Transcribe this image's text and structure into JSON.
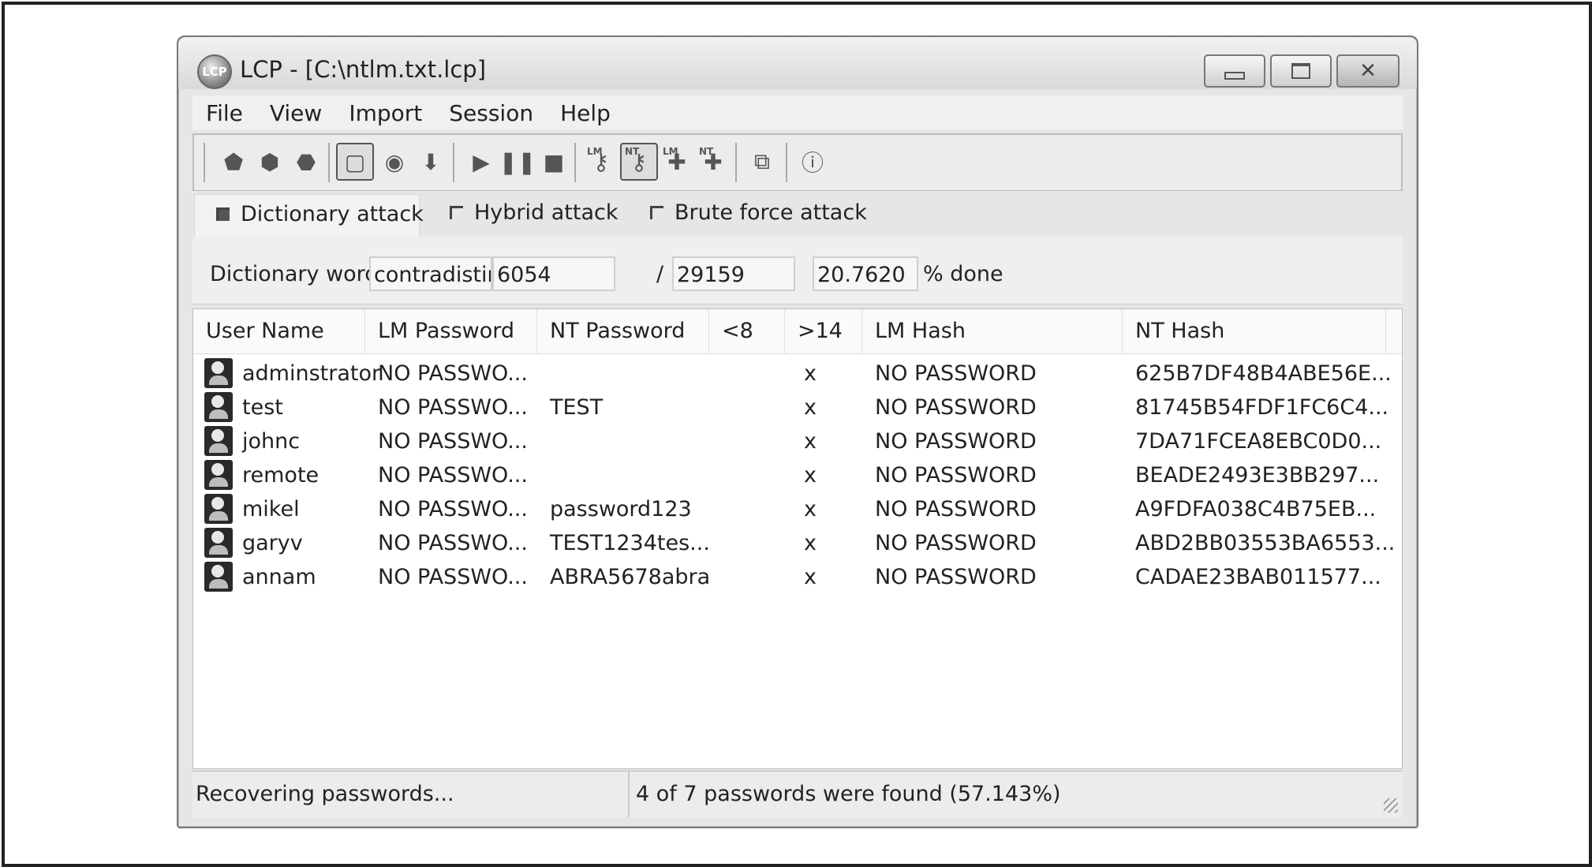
{
  "window": {
    "app_icon_text": "LCP",
    "title": "LCP - [C:\\ntlm.txt.lcp]"
  },
  "menu": [
    "File",
    "View",
    "Import",
    "Session",
    "Help"
  ],
  "toolbar_icons": [
    "new-session-icon",
    "open-session-icon",
    "save-session-icon",
    "pause-view-icon",
    "options-icon",
    "import-icon",
    "start-icon",
    "pause-icon",
    "stop-icon",
    "lm-key-icon",
    "nt-key-icon",
    "lm-add-icon",
    "nt-add-icon",
    "export-icon",
    "info-icon"
  ],
  "toolbar_key_labels": {
    "lm": "LM",
    "nt": "NT"
  },
  "attack_tabs": [
    {
      "label": "Dictionary attack",
      "checked": true
    },
    {
      "label": "Hybrid attack",
      "checked": false
    },
    {
      "label": "Brute force attack",
      "checked": false
    }
  ],
  "dictionary": {
    "label": "Dictionary word:",
    "word": "contradisting",
    "current": "6054",
    "separator": "/",
    "total": "29159",
    "percent": "20.7620",
    "done_label": "% done"
  },
  "table": {
    "columns": [
      "User Name",
      "LM Password",
      "NT Password",
      "<8",
      ">14",
      "LM Hash",
      "NT Hash"
    ],
    "rows": [
      {
        "user": "adminstrator",
        "lm_password": "NO PASSWO...",
        "nt_password": "",
        "lt8": "",
        "gt14": "x",
        "lm_hash": "NO PASSWORD",
        "nt_hash": "625B7DF48B4ABE56E..."
      },
      {
        "user": "test",
        "lm_password": "NO PASSWO...",
        "nt_password": "TEST",
        "lt8": "",
        "gt14": "x",
        "lm_hash": "NO PASSWORD",
        "nt_hash": "81745B54FDF1FC6C4..."
      },
      {
        "user": "johnc",
        "lm_password": "NO PASSWO...",
        "nt_password": "",
        "lt8": "",
        "gt14": "x",
        "lm_hash": "NO PASSWORD",
        "nt_hash": "7DA71FCEA8EBC0D0..."
      },
      {
        "user": "remote",
        "lm_password": "NO PASSWO...",
        "nt_password": "",
        "lt8": "",
        "gt14": "x",
        "lm_hash": "NO PASSWORD",
        "nt_hash": "BEADE2493E3BB297..."
      },
      {
        "user": "mikel",
        "lm_password": "NO PASSWO...",
        "nt_password": "password123",
        "lt8": "",
        "gt14": "x",
        "lm_hash": "NO PASSWORD",
        "nt_hash": "A9FDFA038C4B75EB..."
      },
      {
        "user": "garyv",
        "lm_password": "NO PASSWO...",
        "nt_password": "TEST1234tes...",
        "lt8": "",
        "gt14": "x",
        "lm_hash": "NO PASSWORD",
        "nt_hash": "ABD2BB03553BA6553..."
      },
      {
        "user": "annam",
        "lm_password": "NO PASSWO...",
        "nt_password": "ABRA5678abra",
        "lt8": "",
        "gt14": "x",
        "lm_hash": "NO PASSWORD",
        "nt_hash": "CADAE23BAB011577..."
      }
    ]
  },
  "status": {
    "left": "Recovering passwords...",
    "right": "4 of 7 passwords were found (57.143%)"
  }
}
